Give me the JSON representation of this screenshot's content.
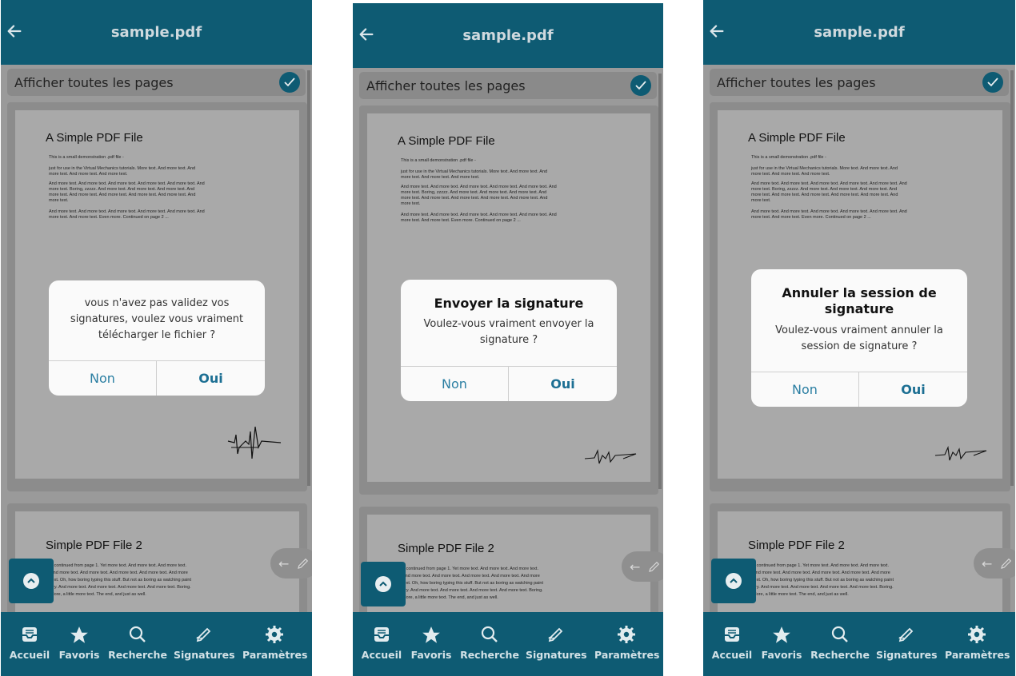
{
  "screens": [
    {
      "header_title": "sample.pdf",
      "toggle_label": "Afficher toutes les pages",
      "page1": {
        "heading": "A Simple PDF File",
        "line1": "This is a small demonstration .pdf file -",
        "para1": "just for use in the Virtual Mechanics tutorials. More text. And more text. And more text. And more text. And more text.",
        "para2": "And more text. And more text. And more text. And more text. And more text. And more text. Boring, zzzzz. And more text. And more text. And more text. And more text. And more text. And more text. And more text. And more text. And more text.",
        "para3": "And more text. And more text. And more text. And more text. And more text. And more text. And more text. Even more. Continued on page 2 ..."
      },
      "page2": {
        "heading": "Simple PDF File 2",
        "para": "...continued from page 1. Yet more text. And more text. And more text. And more text. And more text. And more text. And more text. And more text. Oh, how boring typing this stuff. But not as boring as watching paint dry. And more text. And more text. And more text. And more text. Boring. More, a little more text. The end, and just as well."
      },
      "dialog": {
        "title": "",
        "message": "vous n'avez pas validez vos signatures, voulez vous vraiment télécharger le fichier ?",
        "cancel": "Non",
        "confirm": "Oui"
      },
      "nav": [
        "Accueil",
        "Favoris",
        "Recherche",
        "Signatures",
        "Paramètres"
      ]
    },
    {
      "header_title": "sample.pdf",
      "toggle_label": "Afficher toutes les pages",
      "page1": {
        "heading": "A Simple PDF File",
        "line1": "This is a small demonstration .pdf file -",
        "para1": "just for use in the Virtual Mechanics tutorials. More text. And more text. And more text. And more text. And more text.",
        "para2": "And more text. And more text. And more text. And more text. And more text. And more text. Boring, zzzzz. And more text. And more text. And more text. And more text. And more text. And more text. And more text. And more text. And more text.",
        "para3": "And more text. And more text. And more text. And more text. And more text. And more text. And more text. Even more. Continued on page 2 ..."
      },
      "page2": {
        "heading": "Simple PDF File 2",
        "para": "...continued from page 1. Yet more text. And more text. And more text. And more text. And more text. And more text. And more text. And more text. Oh, how boring typing this stuff. But not as boring as watching paint dry. And more text. And more text. And more text. And more text. Boring. More, a little more text. The end, and just as well."
      },
      "dialog": {
        "title": "Envoyer la signature",
        "message": "Voulez-vous vraiment envoyer la signature ?",
        "cancel": "Non",
        "confirm": "Oui"
      },
      "nav": [
        "Accueil",
        "Favoris",
        "Recherche",
        "Signatures",
        "Paramètres"
      ]
    },
    {
      "header_title": "sample.pdf",
      "toggle_label": "Afficher toutes les pages",
      "page1": {
        "heading": "A Simple PDF File",
        "line1": "This is a small demonstration .pdf file -",
        "para1": "just for use in the Virtual Mechanics tutorials. More text. And more text. And more text. And more text. And more text.",
        "para2": "And more text. And more text. And more text. And more text. And more text. And more text. Boring, zzzzz. And more text. And more text. And more text. And more text. And more text. And more text. And more text. And more text. And more text.",
        "para3": "And more text. And more text. And more text. And more text. And more text. And more text. And more text. Even more. Continued on page 2 ..."
      },
      "page2": {
        "heading": "Simple PDF File 2",
        "para": "...continued from page 1. Yet more text. And more text. And more text. And more text. And more text. And more text. And more text. And more text. Oh, how boring typing this stuff. But not as boring as watching paint dry. And more text. And more text. And more text. And more text. Boring. More, a little more text. The end, and just as well."
      },
      "dialog": {
        "title": "Annuler la session de signature",
        "message": "Voulez-vous vraiment annuler la session de signature ?",
        "cancel": "Non",
        "confirm": "Oui"
      },
      "nav": [
        "Accueil",
        "Favoris",
        "Recherche",
        "Signatures",
        "Paramètres"
      ]
    }
  ],
  "icons": {
    "back": "arrow-left-icon",
    "check": "check-icon",
    "up": "chevron-up-icon",
    "nav": [
      "inbox-icon",
      "star-icon",
      "search-icon",
      "pen-icon",
      "gear-icon"
    ]
  },
  "colors": {
    "brand": "#0e5b73",
    "overlay": "#9a9a9a",
    "dialog_button": "#2a7ea2"
  }
}
